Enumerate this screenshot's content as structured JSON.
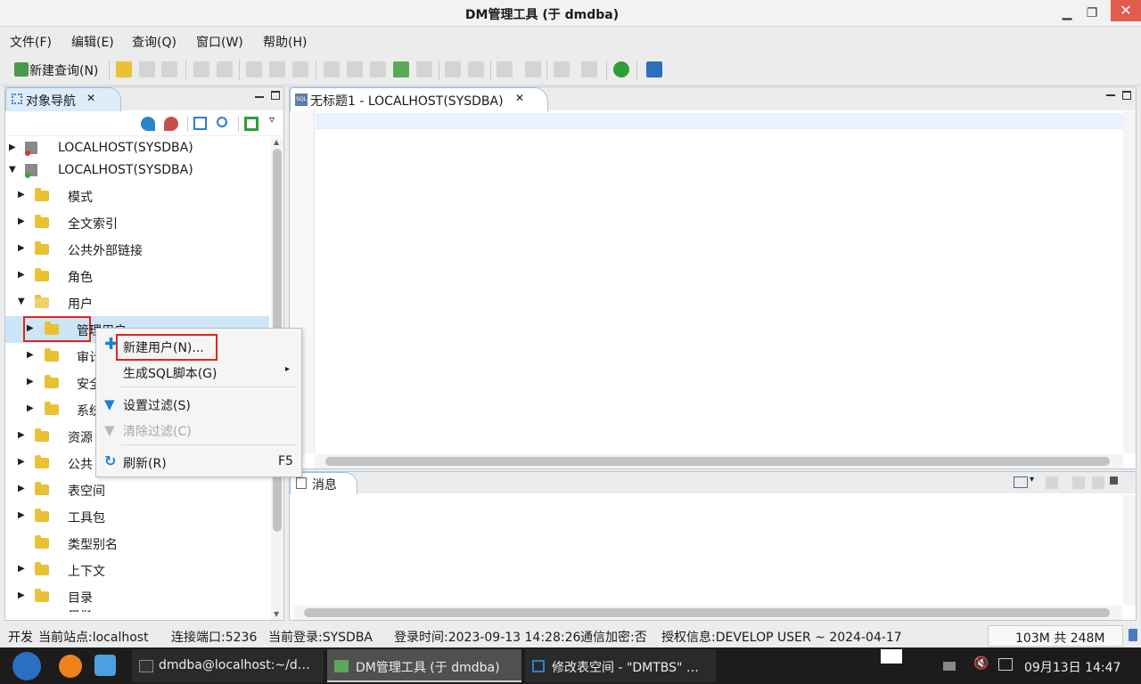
{
  "window": {
    "title": "DM管理工具 (于 dmdba)",
    "minimize": "▁",
    "restore": "❐",
    "close": "✕"
  },
  "menubar": [
    {
      "label": "文件(F)"
    },
    {
      "label": "编辑(E)"
    },
    {
      "label": "查询(Q)"
    },
    {
      "label": "窗口(W)"
    },
    {
      "label": "帮助(H)"
    }
  ],
  "toolbar": {
    "new_query_label": "新建查询(N)"
  },
  "nav": {
    "tab_label": "对象导航",
    "tab_close": "✕",
    "connections": [
      {
        "label": "LOCALHOST(SYSDBA)"
      },
      {
        "label": "LOCALHOST(SYSDBA)"
      }
    ],
    "items": [
      {
        "label": "模式"
      },
      {
        "label": "全文索引"
      },
      {
        "label": "公共外部链接"
      },
      {
        "label": "角色"
      },
      {
        "label": "用户"
      },
      {
        "label": "管理用户"
      },
      {
        "label": "审计"
      },
      {
        "label": "安全"
      },
      {
        "label": "系统"
      },
      {
        "label": "资源"
      },
      {
        "label": "公共"
      },
      {
        "label": "表空间"
      },
      {
        "label": "工具包"
      },
      {
        "label": "类型别名"
      },
      {
        "label": "上下文"
      },
      {
        "label": "目录"
      },
      {
        "label": "备份"
      }
    ]
  },
  "editor": {
    "tab_label": "无标题1 - LOCALHOST(SYSDBA)",
    "tab_icon": "SQL",
    "tab_close": "✕"
  },
  "messages": {
    "tab_label": "消息"
  },
  "context_menu": {
    "items": [
      {
        "label": "新建用户(N)...",
        "icon": "plus-icon"
      },
      {
        "label": "生成SQL脚本(G)",
        "submenu": "▸"
      },
      {
        "label": "设置过滤(S)",
        "icon": "filter-icon"
      },
      {
        "label": "清除过滤(C)",
        "icon": "clear-filter-icon",
        "disabled": true
      },
      {
        "label": "刷新(R)",
        "icon": "refresh-icon",
        "shortcut": "F5"
      }
    ]
  },
  "status": {
    "mode": "开发",
    "site": "当前站点:localhost",
    "port": "连接端口:5236",
    "login": "当前登录:SYSDBA",
    "login_time": "登录时间:2023-09-13 14:28:26",
    "encryption": "通信加密:否",
    "license": "授权信息:DEVELOP USER ~ 2024-04-17",
    "memory": "103M 共 248M"
  },
  "taskbar": {
    "tasks": [
      {
        "label": "dmdba@localhost:~/d…"
      },
      {
        "label": "DM管理工具 (于 dmdba)"
      },
      {
        "label": "修改表空间 - \"DMTBS\" …"
      }
    ],
    "clock": "09月13日 14:47"
  },
  "colors": {
    "accent": "#1e7fd0",
    "highlight_box": "#e0261d",
    "selection": "#cde6f7",
    "folder": "#e8c233"
  }
}
